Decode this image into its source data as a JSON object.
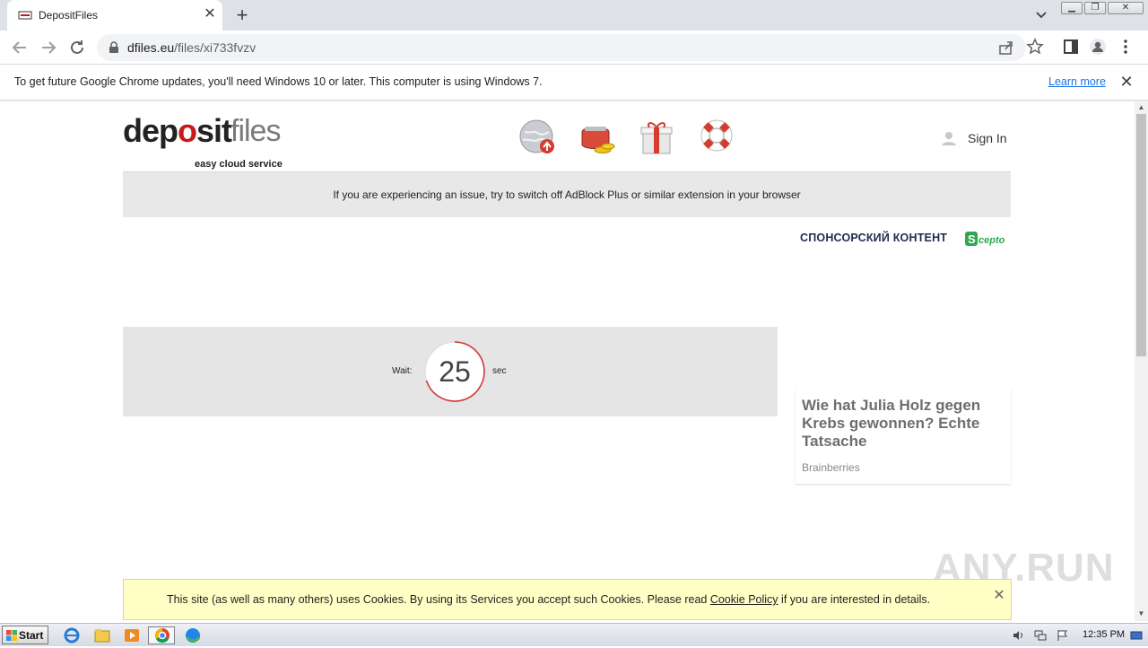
{
  "browser": {
    "tab": {
      "title": "DepositFiles"
    },
    "url": {
      "host": "dfiles.eu",
      "path": "/files/xi733fvzv"
    },
    "infobar": {
      "message": "To get future Google Chrome updates, you'll need Windows 10 or later. This computer is using Windows 7.",
      "link": "Learn more"
    }
  },
  "site": {
    "logo": {
      "word1": "dep",
      "o": "o",
      "word2": "sit",
      "word3": "files",
      "tagline": "easy cloud service"
    },
    "signin": "Sign In",
    "notice": "If you are experiencing an issue, try to switch off AdBlock Plus or similar extension in your browser",
    "sponsor": {
      "label": "СПОНСОРСКИЙ КОНТЕНТ",
      "brand": "Sccepto"
    },
    "wait": {
      "label": "Wait:",
      "seconds": "25",
      "unit": "sec"
    },
    "ad": {
      "title": "Wie hat Julia Holz gegen Krebs gewonnen? Echte Tatsache",
      "source": "Brainberries"
    },
    "cookie": {
      "before": "This site (as well as many others) uses Cookies. By using its Services you accept such Cookies. Please read ",
      "link": "Cookie Policy",
      "after": " if you are interested in details."
    },
    "watermark": "ANY.RUN"
  },
  "taskbar": {
    "start": "Start",
    "clock": "12:35 PM"
  },
  "colors": {
    "accent": "#1a73e8",
    "logo_red": "#c81a1a",
    "cookie_bg": "#ffffc6",
    "timer_ring": "#d33a3a"
  }
}
